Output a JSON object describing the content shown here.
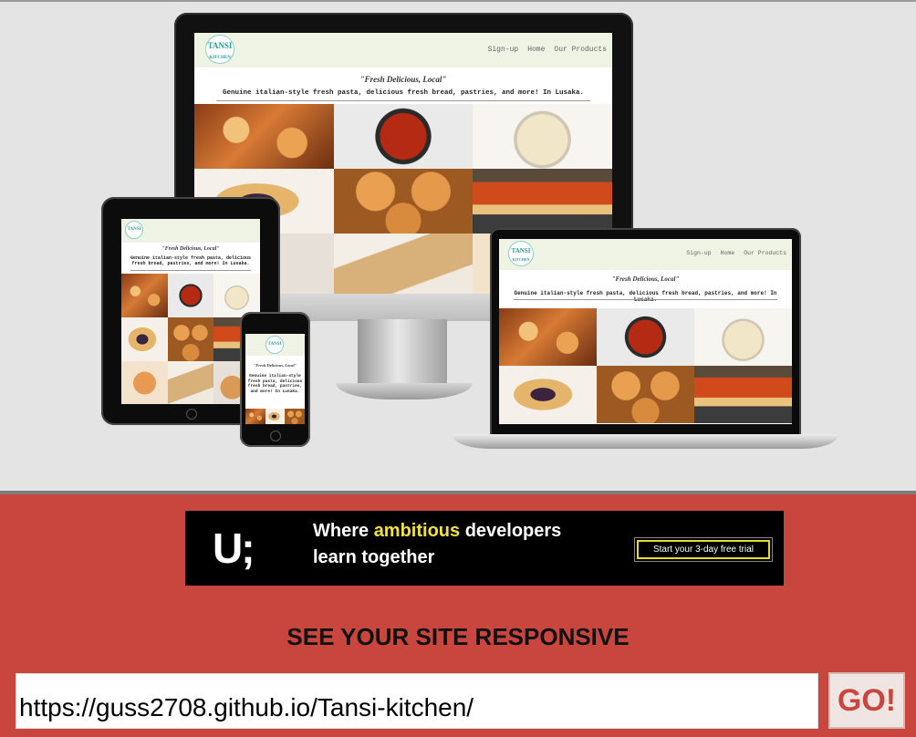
{
  "preview": {
    "site": {
      "logo": "TANSI",
      "logo_sub": "KITCHEN",
      "nav_links": [
        "Sign-up",
        "Home",
        "Our Products"
      ],
      "tagline": "\"Fresh Delicious, Local\"",
      "description": "Genuine italian-style fresh pasta, delicious fresh bread, pastries, and more! In Lusaka."
    }
  },
  "banner": {
    "logo": "U;",
    "line1_pre": "Where ",
    "line1_highlight": "ambitious",
    "line1_post": " developers",
    "line2": "learn together",
    "cta": "Start your 3-day free trial",
    "highlight_color": "#f4e23a"
  },
  "main": {
    "heading": "SEE YOUR SITE RESPONSIVE",
    "url_value": "https://guss2708.github.io/Tansi-kitchen/",
    "go_label": "GO!",
    "accent_color": "#c9463f"
  }
}
